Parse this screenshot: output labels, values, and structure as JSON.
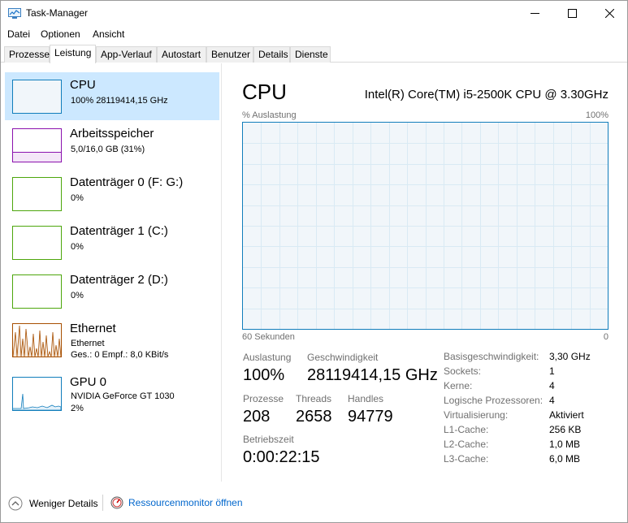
{
  "window": {
    "title": "Task-Manager"
  },
  "menu": [
    "Datei",
    "Optionen",
    "Ansicht"
  ],
  "tabs": [
    "Prozesse",
    "Leistung",
    "App-Verlauf",
    "Autostart",
    "Benutzer",
    "Details",
    "Dienste"
  ],
  "active_tab": "Leistung",
  "sidebar": {
    "items": [
      {
        "title": "CPU",
        "sub1": "100%  28119414,15 GHz",
        "sub2": "",
        "color": "#117dbb"
      },
      {
        "title": "Arbeitsspeicher",
        "sub1": "5,0/16,0 GB (31%)",
        "sub2": "",
        "color": "#8b12ae"
      },
      {
        "title": "Datenträger 0 (F: G:)",
        "sub1": "0%",
        "sub2": "",
        "color": "#4da60c"
      },
      {
        "title": "Datenträger 1 (C:)",
        "sub1": "0%",
        "sub2": "",
        "color": "#4da60c"
      },
      {
        "title": "Datenträger 2 (D:)",
        "sub1": "0%",
        "sub2": "",
        "color": "#4da60c"
      },
      {
        "title": "Ethernet",
        "sub1": "Ethernet",
        "sub2": "Ges.: 0 Empf.: 8,0 KBit/s",
        "color": "#a74f01"
      },
      {
        "title": "GPU 0",
        "sub1": "NVIDIA GeForce GT 1030",
        "sub2": "2%",
        "color": "#117dbb"
      }
    ]
  },
  "main": {
    "title": "CPU",
    "model": "Intel(R) Core(TM) i5-2500K CPU @ 3.30GHz",
    "graph_top_left": "% Auslastung",
    "graph_top_right": "100%",
    "graph_bottom_left": "60 Sekunden",
    "graph_bottom_right": "0",
    "stats": {
      "auslastung_label": "Auslastung",
      "auslastung": "100%",
      "geschw_label": "Geschwindigkeit",
      "geschw": "28119414,15 GHz",
      "prozesse_label": "Prozesse",
      "prozesse": "208",
      "threads_label": "Threads",
      "threads": "2658",
      "handles_label": "Handles",
      "handles": "94779",
      "betriebszeit_label": "Betriebszeit",
      "betriebszeit": "0:00:22:15"
    },
    "info": [
      {
        "label": "Basisgeschwindigkeit:",
        "value": "3,30 GHz"
      },
      {
        "label": "Sockets:",
        "value": "1"
      },
      {
        "label": "Kerne:",
        "value": "4"
      },
      {
        "label": "Logische Prozessoren:",
        "value": "4"
      },
      {
        "label": "Virtualisierung:",
        "value": "Aktiviert"
      },
      {
        "label": "L1-Cache:",
        "value": "256 KB"
      },
      {
        "label": "L2-Cache:",
        "value": "1,0 MB"
      },
      {
        "label": "L3-Cache:",
        "value": "6,0 MB"
      }
    ]
  },
  "footer": {
    "less_details": "Weniger Details",
    "resource_monitor": "Ressourcenmonitor öffnen"
  },
  "icons": {
    "minimize": "minimize-icon",
    "maximize": "maximize-icon",
    "close": "close-icon",
    "chevron": "chevron-up-icon",
    "monitor": "resource-monitor-icon"
  }
}
